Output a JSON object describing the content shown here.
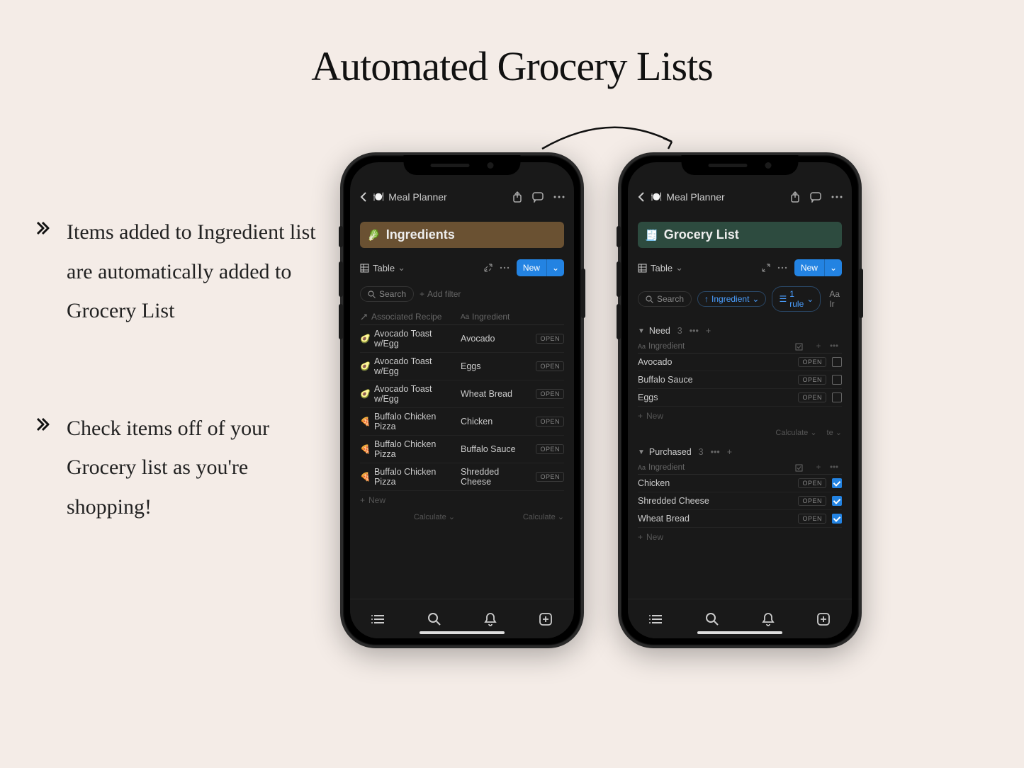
{
  "heading": "Automated Grocery Lists",
  "bullets": [
    "Items added to Ingredient list are automatically added to Grocery List",
    "Check items off of your Grocery list as you're shopping!"
  ],
  "common": {
    "pageTitle": "Meal Planner",
    "tableTab": "Table",
    "newBtn": "New",
    "search": "Search",
    "addFilter": "Add filter",
    "open": "OPEN",
    "newRow": "New",
    "calculate": "Calculate",
    "aaIngredient": "Ingredient",
    "te": "te"
  },
  "left": {
    "blockTitle": "Ingredients",
    "col1": "Associated Recipe",
    "col2": "Ingredient",
    "rows": [
      {
        "emoji": "🥑",
        "recipe": "Avocado Toast w/Egg",
        "ingredient": "Avocado"
      },
      {
        "emoji": "🥑",
        "recipe": "Avocado Toast w/Egg",
        "ingredient": "Eggs"
      },
      {
        "emoji": "🥑",
        "recipe": "Avocado Toast w/Egg",
        "ingredient": "Wheat Bread"
      },
      {
        "emoji": "🍕",
        "recipe": "Buffalo Chicken Pizza",
        "ingredient": "Chicken"
      },
      {
        "emoji": "🍕",
        "recipe": "Buffalo Chicken Pizza",
        "ingredient": "Buffalo Sauce"
      },
      {
        "emoji": "🍕",
        "recipe": "Buffalo Chicken Pizza",
        "ingredient": "Shredded Cheese"
      }
    ]
  },
  "right": {
    "blockTitle": "Grocery List",
    "chipIngredient": "Ingredient",
    "chipRule": "1 rule",
    "aaTrunc": "Aa Ir",
    "groups": [
      {
        "name": "Need",
        "count": "3",
        "items": [
          {
            "name": "Avocado",
            "checked": false
          },
          {
            "name": "Buffalo Sauce",
            "checked": false
          },
          {
            "name": "Eggs",
            "checked": false
          }
        ]
      },
      {
        "name": "Purchased",
        "count": "3",
        "items": [
          {
            "name": "Chicken",
            "checked": true
          },
          {
            "name": "Shredded Cheese",
            "checked": true
          },
          {
            "name": "Wheat Bread",
            "checked": true
          }
        ]
      }
    ]
  }
}
